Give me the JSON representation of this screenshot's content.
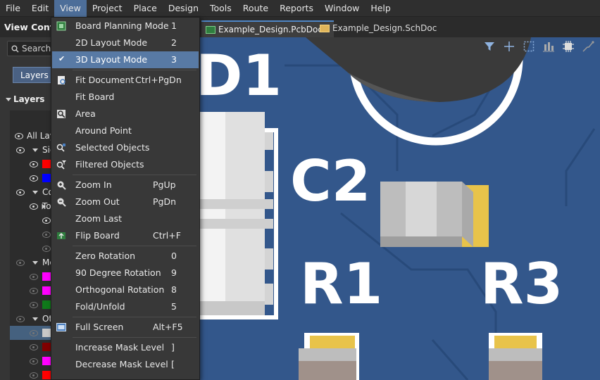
{
  "menubar": [
    "File",
    "Edit",
    "View",
    "Project",
    "Place",
    "Design",
    "Tools",
    "Route",
    "Reports",
    "Window",
    "Help"
  ],
  "panel": {
    "title": "View Configuration",
    "search_placeholder": "Search",
    "tab_label": "Layers & Colors",
    "section_label": "Layers",
    "tree": [
      "All Layers",
      "Signal Layers",
      "Components",
      "Top",
      "Mechanical",
      "Other"
    ]
  },
  "doc_tabs": [
    {
      "label": "Example_Design.PcbDoc *",
      "active": true
    },
    {
      "label": "Example_Design.SchDoc",
      "active": false
    }
  ],
  "canvas": {
    "designators": [
      "D1",
      "C2",
      "R1",
      "R3"
    ],
    "colors": {
      "board": "#33578b",
      "silkscreen": "#ffffff",
      "pad": "#e8c34a",
      "trace": "#284a7a"
    }
  },
  "view_menu": [
    {
      "label": "Board Planning Mode",
      "shortcut": "1"
    },
    {
      "label": "2D Layout Mode",
      "shortcut": "2"
    },
    {
      "label": "3D Layout Mode",
      "shortcut": "3",
      "checked": true,
      "highlighted": true
    },
    {
      "label": "Fit Document",
      "shortcut": "Ctrl+PgDn"
    },
    {
      "label": "Fit Board",
      "shortcut": ""
    },
    {
      "label": "Area",
      "shortcut": ""
    },
    {
      "label": "Around Point",
      "shortcut": ""
    },
    {
      "label": "Selected Objects",
      "shortcut": ""
    },
    {
      "label": "Filtered Objects",
      "shortcut": ""
    },
    {
      "label": "Zoom In",
      "shortcut": "PgUp"
    },
    {
      "label": "Zoom Out",
      "shortcut": "PgDn"
    },
    {
      "label": "Zoom Last",
      "shortcut": ""
    },
    {
      "label": "Flip Board",
      "shortcut": "Ctrl+F"
    },
    {
      "label": "Zero Rotation",
      "shortcut": "0"
    },
    {
      "label": "90 Degree Rotation",
      "shortcut": "9"
    },
    {
      "label": "Orthogonal Rotation",
      "shortcut": "8"
    },
    {
      "label": "Fold/Unfold",
      "shortcut": "5"
    },
    {
      "label": "Full Screen",
      "shortcut": "Alt+F5"
    },
    {
      "label": "Increase Mask Level",
      "shortcut": "]"
    },
    {
      "label": "Decrease Mask Level",
      "shortcut": "["
    }
  ]
}
